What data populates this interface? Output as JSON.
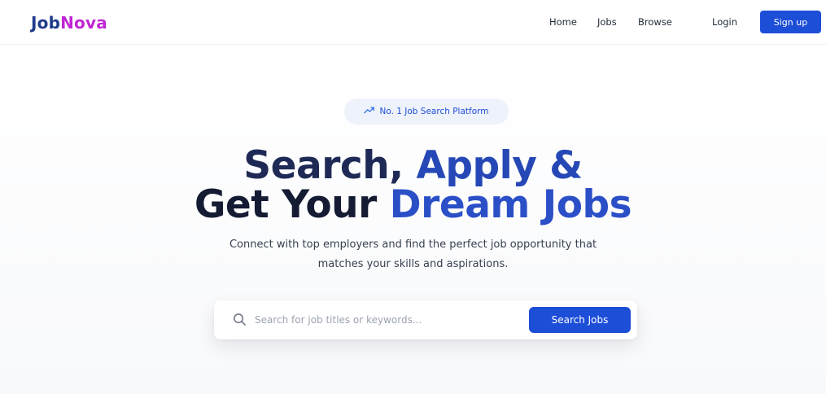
{
  "brand": {
    "part1": "Job",
    "part2": "Nova"
  },
  "nav": {
    "home": "Home",
    "jobs": "Jobs",
    "browse": "Browse",
    "login": "Login",
    "signup": "Sign up"
  },
  "badge": {
    "icon": "trending-up-icon",
    "text": "No. 1 Job Search Platform"
  },
  "headline": {
    "line1_dark": "Search, ",
    "line1_blue": "Apply &",
    "line2_dark": "Get Your ",
    "line2_blue": "Dream Jobs"
  },
  "subtitle": {
    "line1": "Connect with top employers and find the perfect job opportunity that",
    "line2": "matches your skills and aspirations."
  },
  "search": {
    "icon": "search-icon",
    "placeholder": "Search for job titles or keywords...",
    "value": "",
    "button": "Search Jobs"
  },
  "colors": {
    "primary": "#1d4ed8",
    "brand_dark": "#1e3a8a",
    "brand_accent": "#c026d3",
    "headline_dark": "#1e2a55",
    "headline_blue": "#2548b6"
  }
}
